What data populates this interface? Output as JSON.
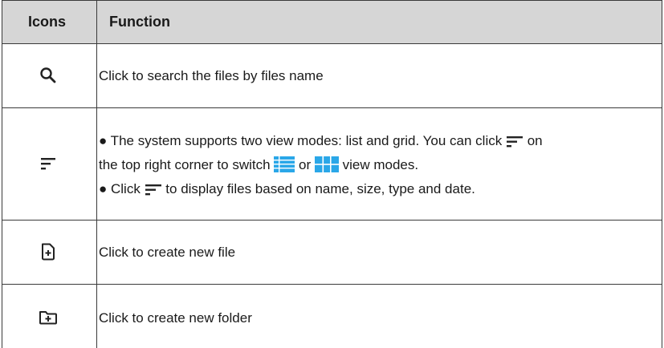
{
  "table": {
    "headers": {
      "icons": "Icons",
      "function": "Function"
    },
    "rows": [
      {
        "icon": "search-icon",
        "text": "Click to search the files by files name"
      },
      {
        "icon": "sort-icon",
        "bullet1_part1": "● The system supports two view modes: list and grid. You can click",
        "bullet1_part2": "on",
        "bullet1_line2_a": "the top right corner to switch",
        "bullet1_line2_b": "or",
        "bullet1_line2_c": "view modes.",
        "bullet2_part1": "● Click",
        "bullet2_part2": "to display files based on name, size, type and date."
      },
      {
        "icon": "new-file-icon",
        "text": "Click to create new file"
      },
      {
        "icon": "new-folder-icon",
        "text": "Click to create new folder"
      }
    ]
  },
  "colors": {
    "header_bg": "#d6d6d6",
    "border": "#3a3a3a",
    "accent_blue": "#2aa7e8"
  }
}
